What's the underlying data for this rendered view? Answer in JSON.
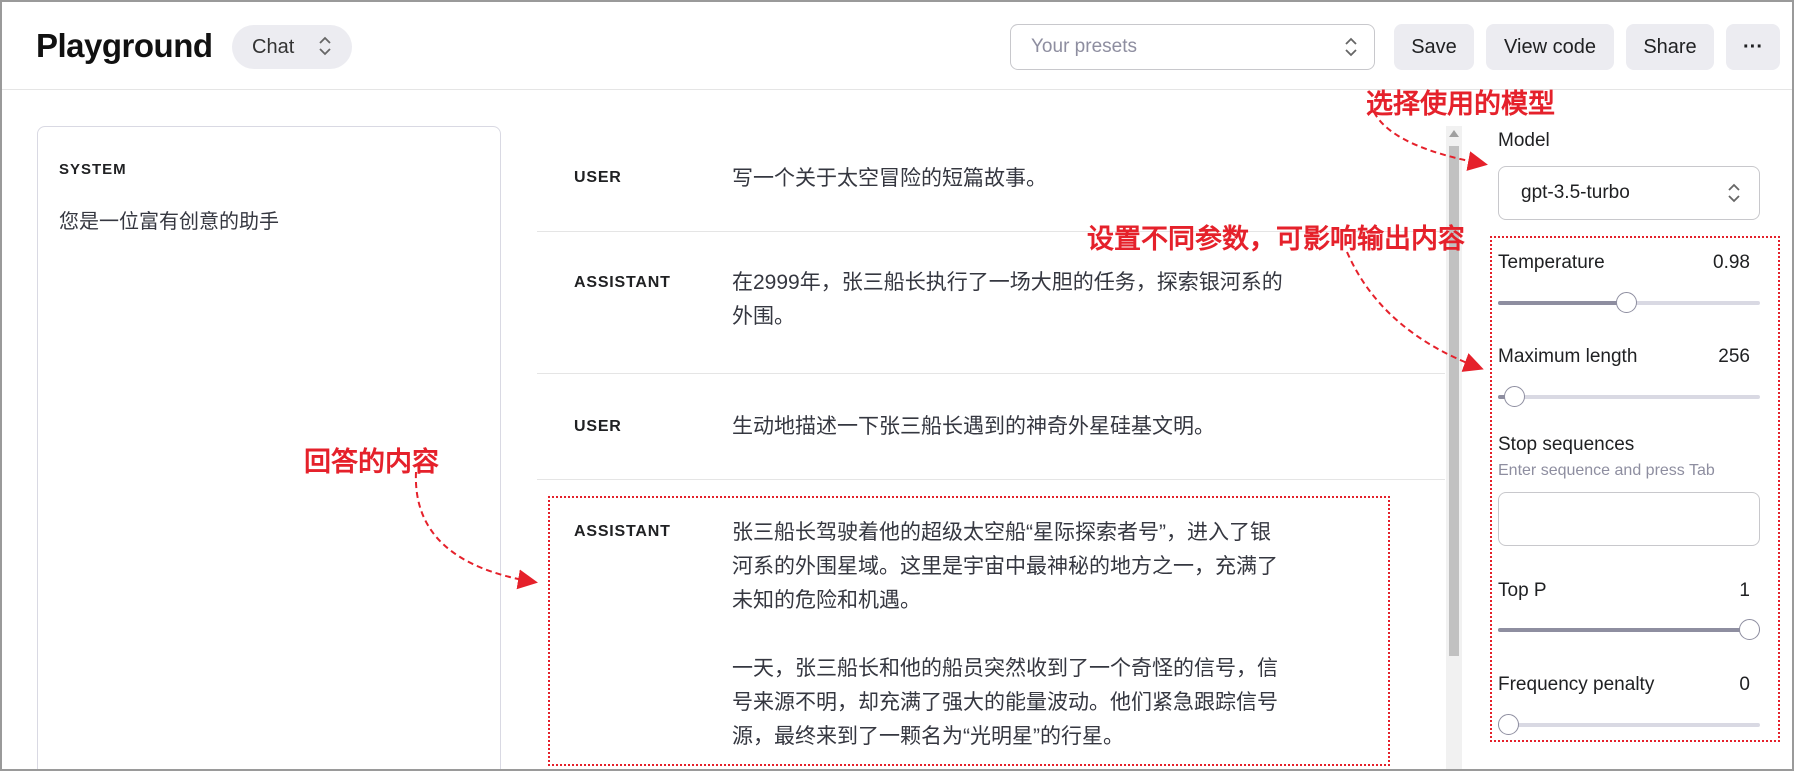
{
  "header": {
    "title": "Playground",
    "mode": "Chat",
    "preset_placeholder": "Your presets",
    "buttons": {
      "save": "Save",
      "view_code": "View code",
      "share": "Share",
      "more": "···"
    }
  },
  "system": {
    "label": "SYSTEM",
    "text": "您是一位富有创意的助手"
  },
  "messages": [
    {
      "role": "USER",
      "lines": [
        "写一个关于太空冒险的短篇故事。"
      ]
    },
    {
      "role": "ASSISTANT",
      "lines": [
        "在2999年，张三船长执行了一场大胆的任务，探索银河系的",
        "外围。"
      ]
    },
    {
      "role": "USER",
      "lines": [
        "生动地描述一下张三船长遇到的神奇外星硅基文明。"
      ]
    },
    {
      "role": "ASSISTANT",
      "paragraphs": [
        [
          "张三船长驾驶着他的超级太空船“星际探索者号”，进入了银",
          "河系的外围星域。这里是宇宙中最神秘的地方之一，充满了",
          "未知的危险和机遇。"
        ],
        [
          "一天，张三船长和他的船员突然收到了一个奇怪的信号，信",
          "号来源不明，却充满了强大的能量波动。他们紧急跟踪信号",
          "源，最终来到了一颗名为“光明星”的行星。"
        ]
      ]
    }
  ],
  "settings": {
    "model": {
      "label": "Model",
      "value": "gpt-3.5-turbo"
    },
    "temperature": {
      "label": "Temperature",
      "value": "0.98",
      "fraction": 0.49
    },
    "max_length": {
      "label": "Maximum length",
      "value": "256",
      "fraction": 0.06
    },
    "stop_sequences": {
      "label": "Stop sequences",
      "hint": "Enter sequence and press Tab"
    },
    "top_p": {
      "label": "Top P",
      "value": "1",
      "fraction": 1.0
    },
    "frequency_penalty": {
      "label": "Frequency penalty",
      "value": "0",
      "fraction": 0.0
    }
  },
  "annotations": {
    "model_note": "选择使用的模型",
    "params_note": "设置不同参数，可影响输出内容",
    "answer_note": "回答的内容"
  },
  "colors": {
    "annotation": "#e5212b",
    "accent_gray": "#ececf1"
  }
}
